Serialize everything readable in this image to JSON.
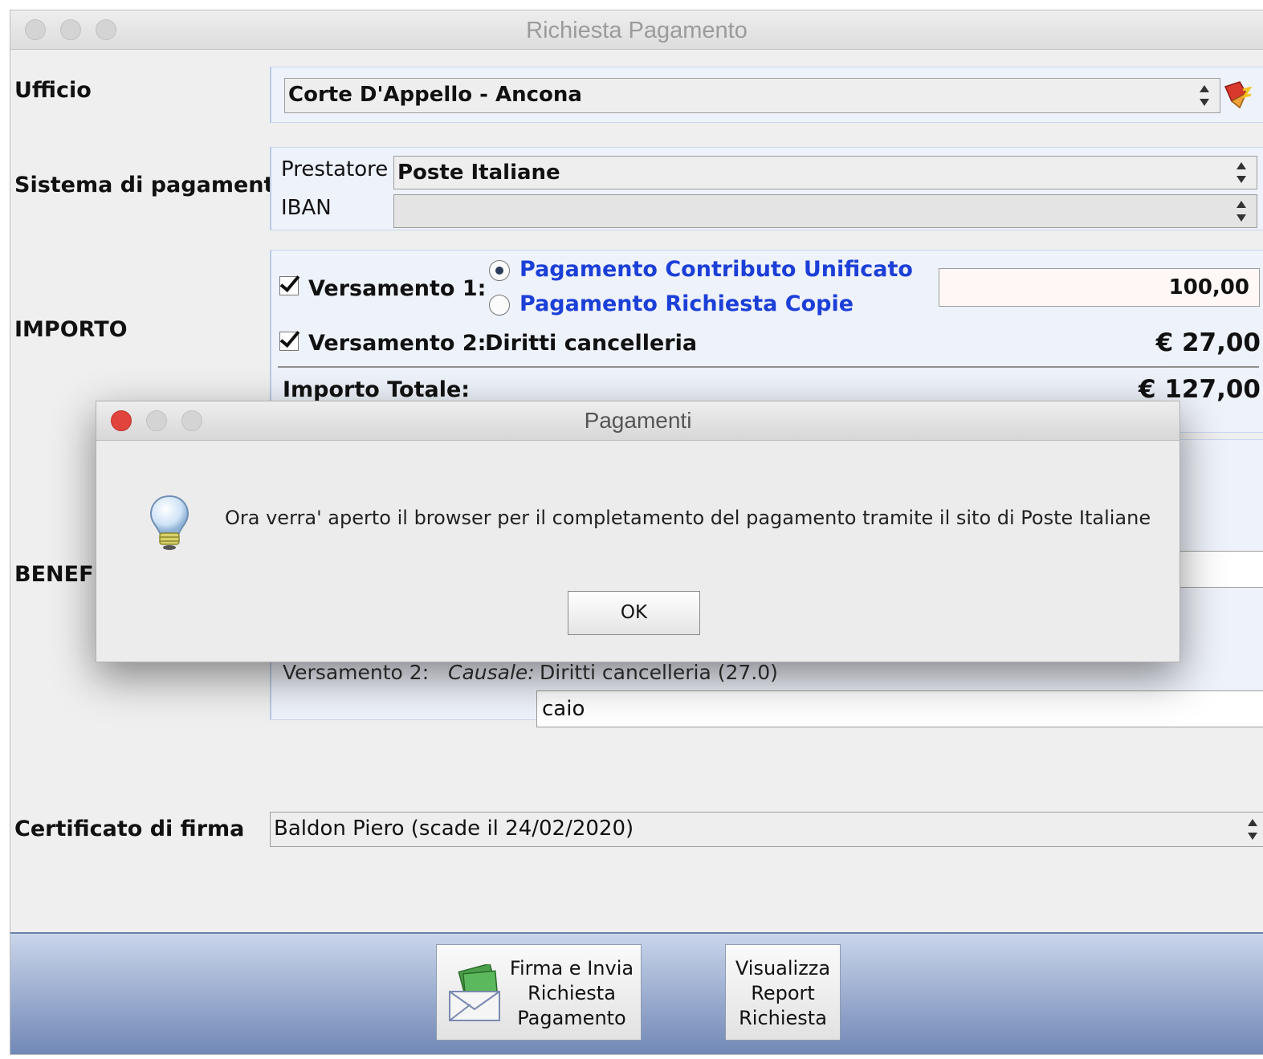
{
  "window": {
    "title": "Richiesta Pagamento"
  },
  "ufficio": {
    "label": "Ufficio",
    "value": "Corte D'Appello - Ancona"
  },
  "sistema": {
    "label": "Sistema di pagamento",
    "prestatore_label": "Prestatore",
    "prestatore_value": "Poste Italiane",
    "iban_label": "IBAN",
    "iban_value": ""
  },
  "importo": {
    "label": "IMPORTO",
    "versamento1_label": "Versamento 1:",
    "versamento1_checked": true,
    "option1": "Pagamento Contributo Unificato",
    "option2": "Pagamento Richiesta Copie",
    "selected_option": "Pagamento Contributo Unificato",
    "amount1": "100,00",
    "versamento2_label": "Versamento 2:",
    "versamento2_checked": true,
    "versamento2_desc": "Diritti cancelleria",
    "amount2": "€ 27,00",
    "totale_label": "Importo Totale:",
    "totale_value": "€ 127,00"
  },
  "beneficiario": {
    "label_partial": "BENEFI",
    "versamento2_label": "Versamento 2:",
    "causale_label": "Causale:",
    "causale_value": "Diritti cancelleria (27.0)",
    "field_value": "caio"
  },
  "certificato": {
    "label": "Certificato di firma",
    "value": "Baldon Piero (scade il 24/02/2020)"
  },
  "buttons": {
    "firma_line1": "Firma e Invia",
    "firma_line2": "Richiesta",
    "firma_line3": "Pagamento",
    "report_line1": "Visualizza",
    "report_line2": "Report",
    "report_line3": "Richiesta"
  },
  "dialog": {
    "title": "Pagamenti",
    "message": "Ora verra' aperto il browser per il completamento del pagamento tramite il sito di Poste Italiane",
    "ok_label": "OK",
    "icon": "lightbulb-icon"
  },
  "colors": {
    "accent_blue": "#1c3fd8",
    "bottom_bar": "#6f86b5",
    "close_red": "#e0443c"
  }
}
